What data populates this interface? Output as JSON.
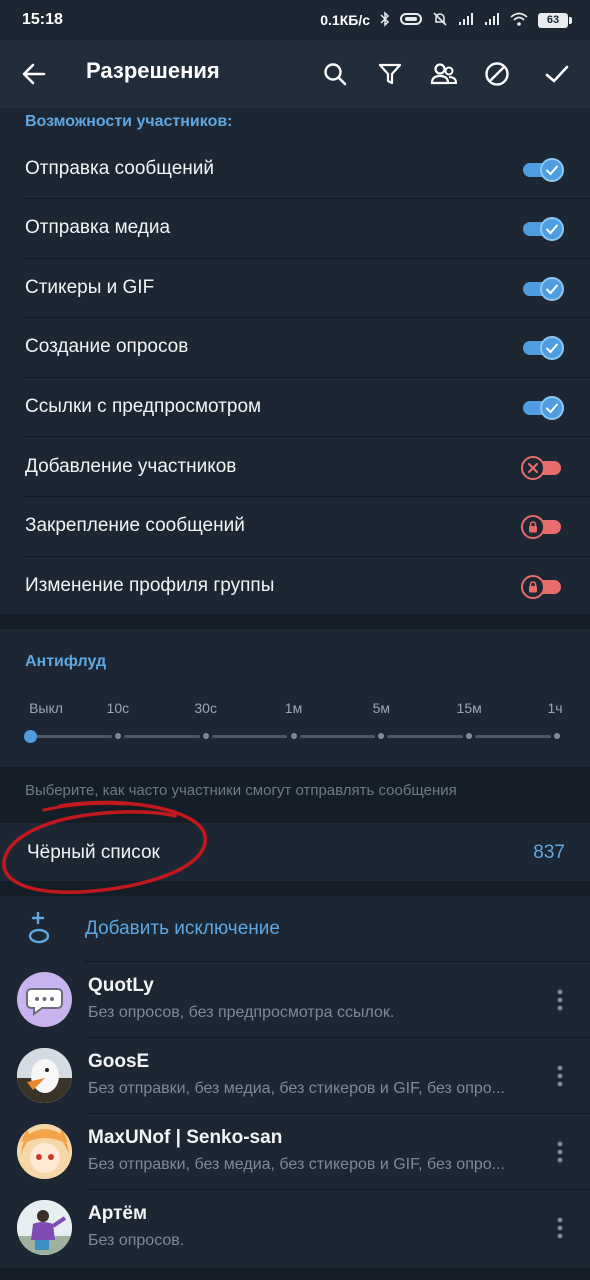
{
  "status_bar": {
    "time": "15:18",
    "speed": "0.1КБ/с",
    "battery": "63"
  },
  "app_bar": {
    "title": "Разрешения",
    "icons": [
      "back-arrow-icon",
      "search-icon",
      "filter-icon",
      "users-icon",
      "block-icon",
      "check-icon"
    ]
  },
  "permissions": {
    "header": "Возможности участников:",
    "items": [
      {
        "label": "Отправка сообщений",
        "state": "on"
      },
      {
        "label": "Отправка медиа",
        "state": "on"
      },
      {
        "label": "Стикеры и GIF",
        "state": "on"
      },
      {
        "label": "Создание опросов",
        "state": "on"
      },
      {
        "label": "Ссылки с предпросмотром",
        "state": "on"
      },
      {
        "label": "Добавление участников",
        "state": "off-x"
      },
      {
        "label": "Закрепление сообщений",
        "state": "off-lock"
      },
      {
        "label": "Изменение профиля группы",
        "state": "off-lock"
      }
    ]
  },
  "antiflood": {
    "header": "Антифлуд",
    "options": [
      "Выкл",
      "10с",
      "30с",
      "1м",
      "5м",
      "15м",
      "1ч"
    ],
    "selected_index": 0,
    "hint": "Выберите, как часто участники смогут отправлять сообщения"
  },
  "blacklist": {
    "label": "Чёрный список",
    "count": "837"
  },
  "exceptions": {
    "add_label": "Добавить исключение",
    "users": [
      {
        "name": "QuotLy",
        "desc": "Без опросов, без предпросмотра ссылок."
      },
      {
        "name": "GoosE",
        "desc": "Без отправки, без медиа, без стикеров и GIF, без опро..."
      },
      {
        "name": "MaxUNof | Senko-san",
        "desc": "Без отправки, без медиа, без стикеров и GIF, без опро..."
      },
      {
        "name": "Артём",
        "desc": "Без опросов."
      }
    ]
  },
  "colors": {
    "accent": "#5fa7e3",
    "toggle_on": "#4d9de0",
    "toggle_off": "#e96c6c",
    "background": "#151e27",
    "surface": "#1d2733",
    "annotation": "#c2181e"
  }
}
